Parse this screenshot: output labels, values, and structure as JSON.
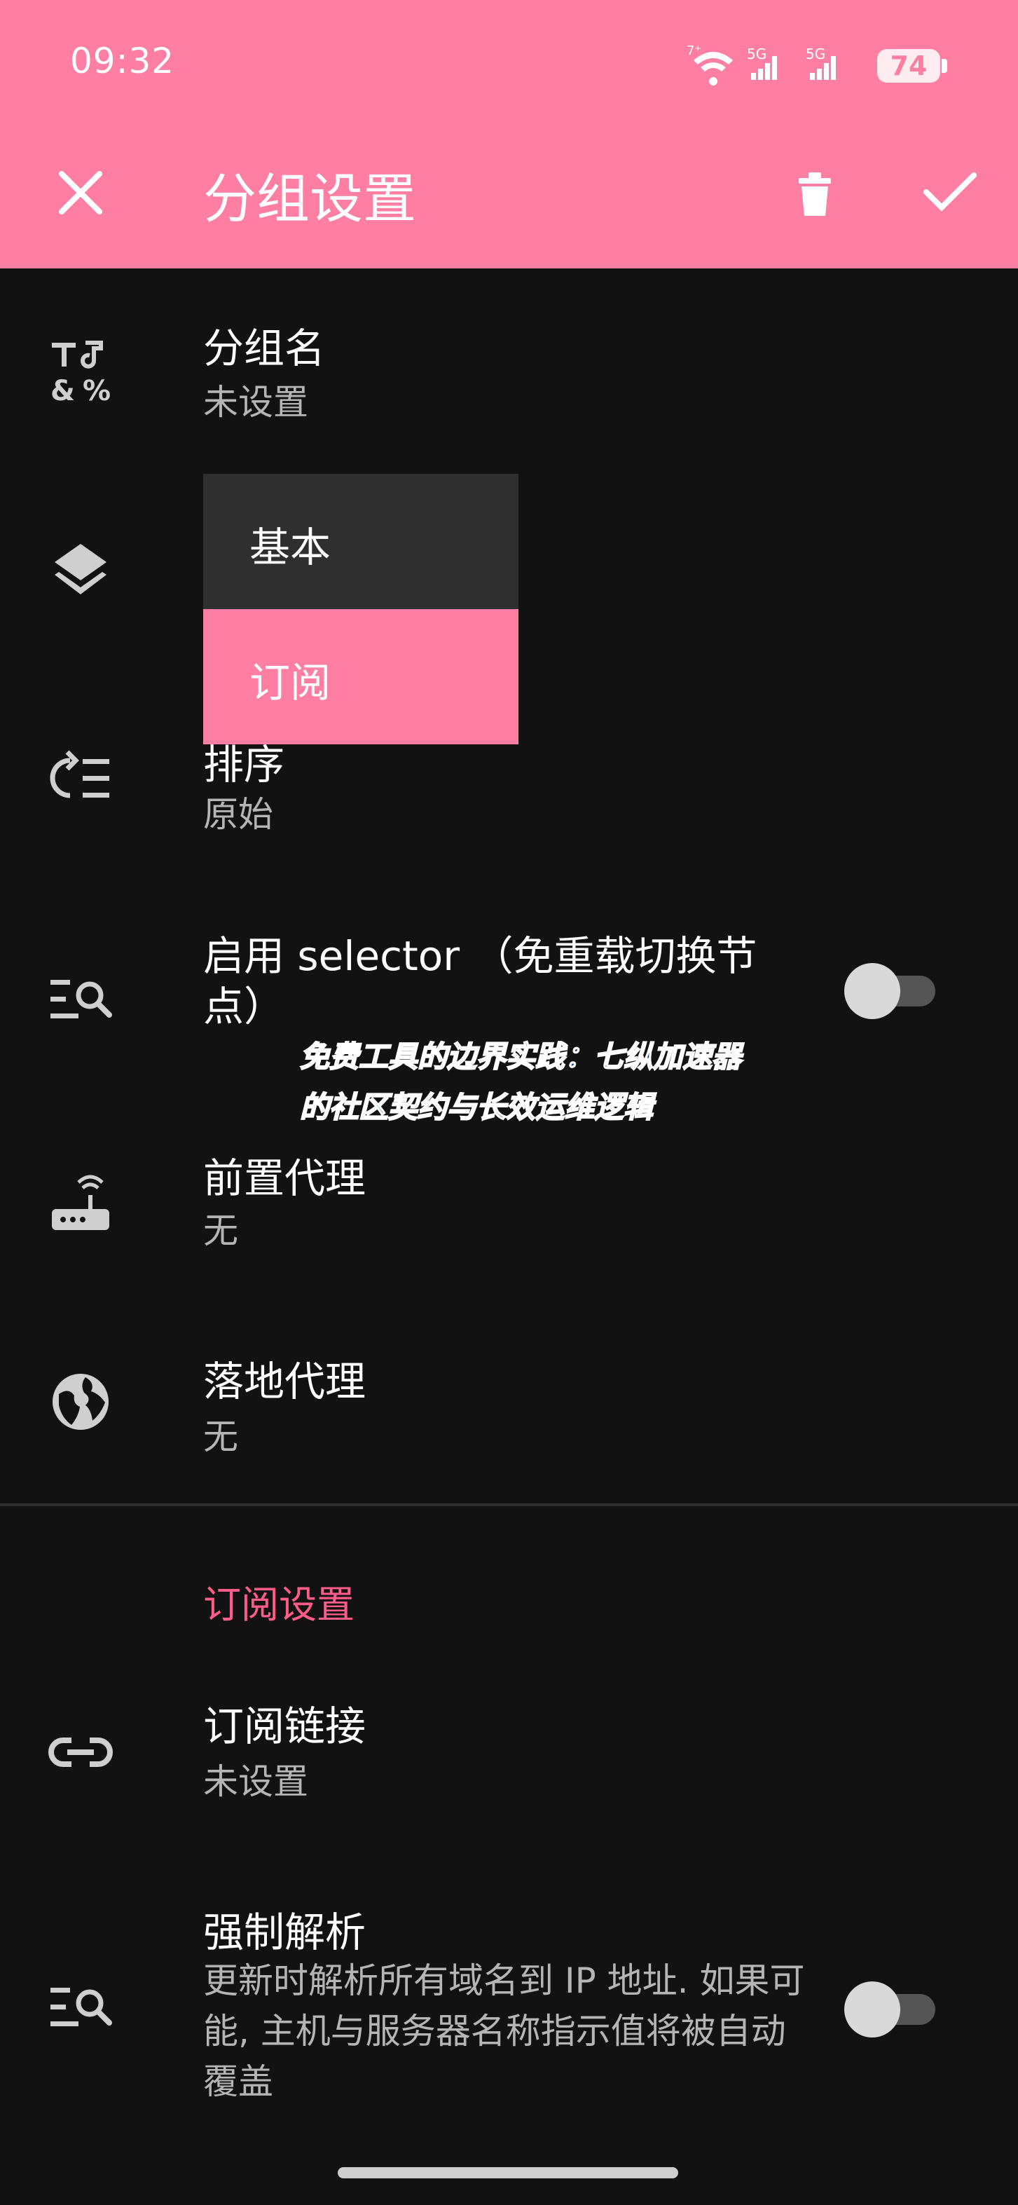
{
  "status_bar": {
    "time": "09:32",
    "battery": "74",
    "network_labels": [
      "5G",
      "5G"
    ]
  },
  "app_bar": {
    "title": "分组设置",
    "close_icon": "close-icon",
    "delete_icon": "trash-icon",
    "confirm_icon": "check-icon"
  },
  "settings": {
    "group_name": {
      "label": "分组名",
      "value": "未设置"
    },
    "sort": {
      "label": "排序",
      "value": "原始"
    },
    "selector": {
      "label": "启用 selector （免重载切换节点）",
      "enabled": false
    },
    "front_proxy": {
      "label": "前置代理",
      "value": "无"
    },
    "landing_proxy": {
      "label": "落地代理",
      "value": "无"
    }
  },
  "type_menu": {
    "options": [
      "基本",
      "订阅"
    ],
    "selected": "订阅"
  },
  "subscription": {
    "header": "订阅设置",
    "link": {
      "label": "订阅链接",
      "value": "未设置"
    },
    "force_resolve": {
      "label": "强制解析",
      "description": "更新时解析所有域名到 IP 地址. 如果可能, 主机与服务器名称指示值将被自动覆盖",
      "enabled": false
    }
  },
  "overlay": {
    "watermark": "免费工具的边界实践：七纵加速器的社区契约与长效运维逻辑"
  },
  "colors": {
    "accent": "#FF7EA3",
    "section_header": "#FF5C8A",
    "background": "#121212",
    "menu_bg": "#2f2f2f"
  }
}
